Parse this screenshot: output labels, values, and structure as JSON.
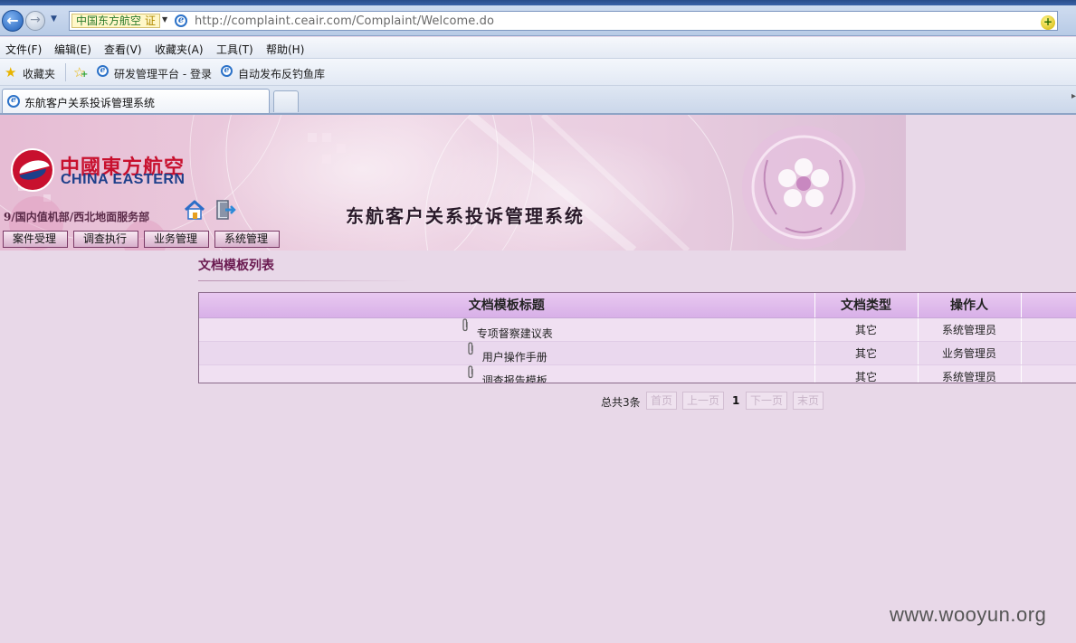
{
  "browser": {
    "address": {
      "cert_label": "中国东方航空",
      "cert_badge": "证",
      "url": "http://complaint.ceair.com/Complaint/Welcome.do"
    },
    "menu": [
      "文件(F)",
      "编辑(E)",
      "查看(V)",
      "收藏夹(A)",
      "工具(T)",
      "帮助(H)"
    ],
    "favorites": {
      "label": "收藏夹",
      "links": [
        "研发管理平台 - 登录",
        "自动发布反钓鱼库"
      ]
    },
    "tab": {
      "title": "东航客户关系投诉管理系统"
    }
  },
  "banner": {
    "logo_cn": "中國東方航空",
    "logo_en": "CHINA EASTERN",
    "system_title": "东航客户关系投诉管理系统",
    "department": "9/国内值机部/西北地面服务部"
  },
  "nav": [
    "案件受理",
    "调查执行",
    "业务管理",
    "系统管理"
  ],
  "section": {
    "title": "文档模板列表"
  },
  "table": {
    "headers": [
      "文档模板标题",
      "文档类型",
      "操作人"
    ],
    "rows": [
      {
        "title": "专项督察建议表",
        "type": "其它",
        "operator": "系统管理员"
      },
      {
        "title": "用户操作手册",
        "type": "其它",
        "operator": "业务管理员"
      },
      {
        "title": "调查报告模板",
        "type": "其它",
        "operator": "系统管理员"
      }
    ]
  },
  "pager": {
    "total": "总共3条",
    "first": "首页",
    "prev": "上一页",
    "current": "1",
    "next": "下一页",
    "last": "末页"
  },
  "watermark": "www.wooyun.org",
  "icons": {
    "back": "back-arrow-icon",
    "forward": "forward-arrow-icon",
    "ie": "ie-page-icon",
    "go": "go-icon",
    "favorites": "star-icon",
    "add_favorite": "add-favorite-icon",
    "home": "home-icon",
    "exit": "exit-icon",
    "attachment": "paperclip-icon"
  },
  "colors": {
    "page_bg": "#e8d8e8",
    "header_row": "#d8b0e8",
    "brand_red": "#c8102e",
    "brand_blue": "#1d3f8a",
    "section_title": "#6a1a50"
  }
}
